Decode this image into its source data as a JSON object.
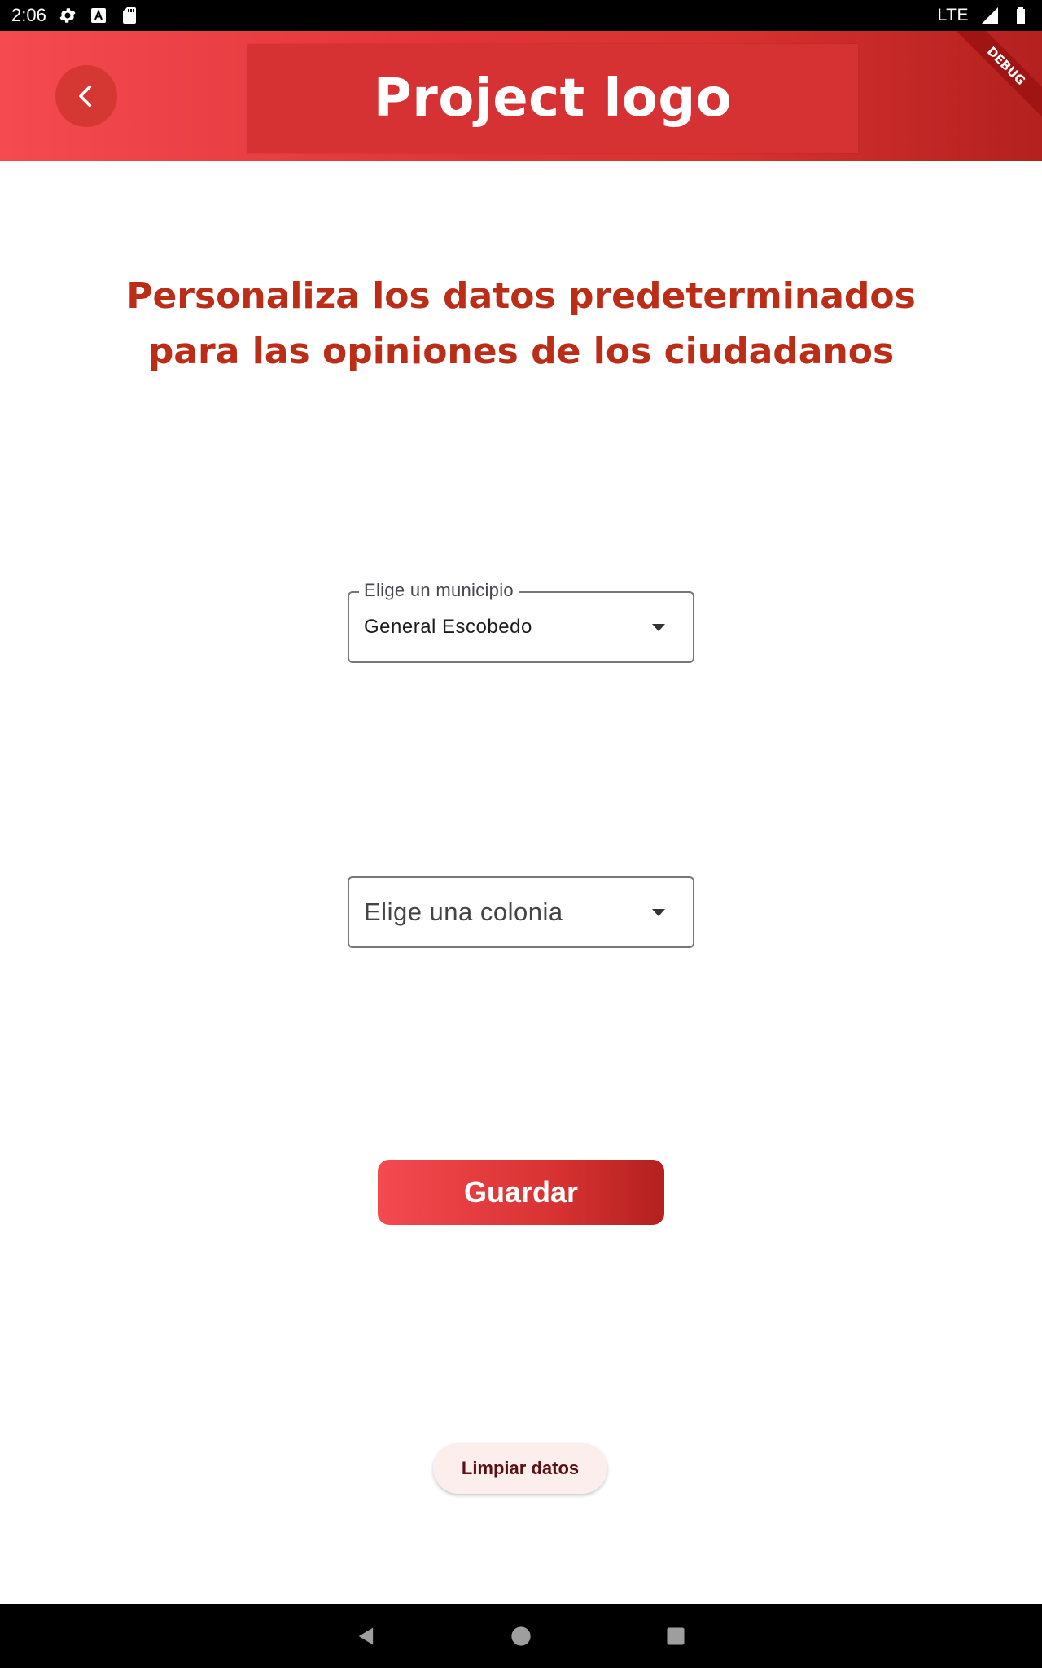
{
  "status_bar": {
    "time": "2:06",
    "network": "LTE",
    "icons": [
      "gear-icon",
      "font-a-icon",
      "sd-card-icon",
      "signal-icon",
      "battery-icon"
    ]
  },
  "app_bar": {
    "logo_text": "Project logo",
    "back_icon": "chevron-left-icon",
    "debug_banner": "DEBUG",
    "gradient_colors": [
      "#f44a50",
      "#b3211f"
    ]
  },
  "main": {
    "title": "Personaliza los datos predeterminados para las opiniones de los ciudadanos",
    "municipio": {
      "label": "Elige un municipio",
      "value": "General Escobedo"
    },
    "colonia": {
      "placeholder": "Elige una colonia"
    },
    "save_label": "Guardar",
    "clear_label": "Limpiar datos"
  },
  "nav_bar": {
    "icons": [
      "back-triangle-icon",
      "home-circle-icon",
      "recents-square-icon"
    ]
  },
  "colors": {
    "accent": "#bc2d17",
    "primary": "#d93131",
    "clear_bg": "#fdeeee"
  }
}
